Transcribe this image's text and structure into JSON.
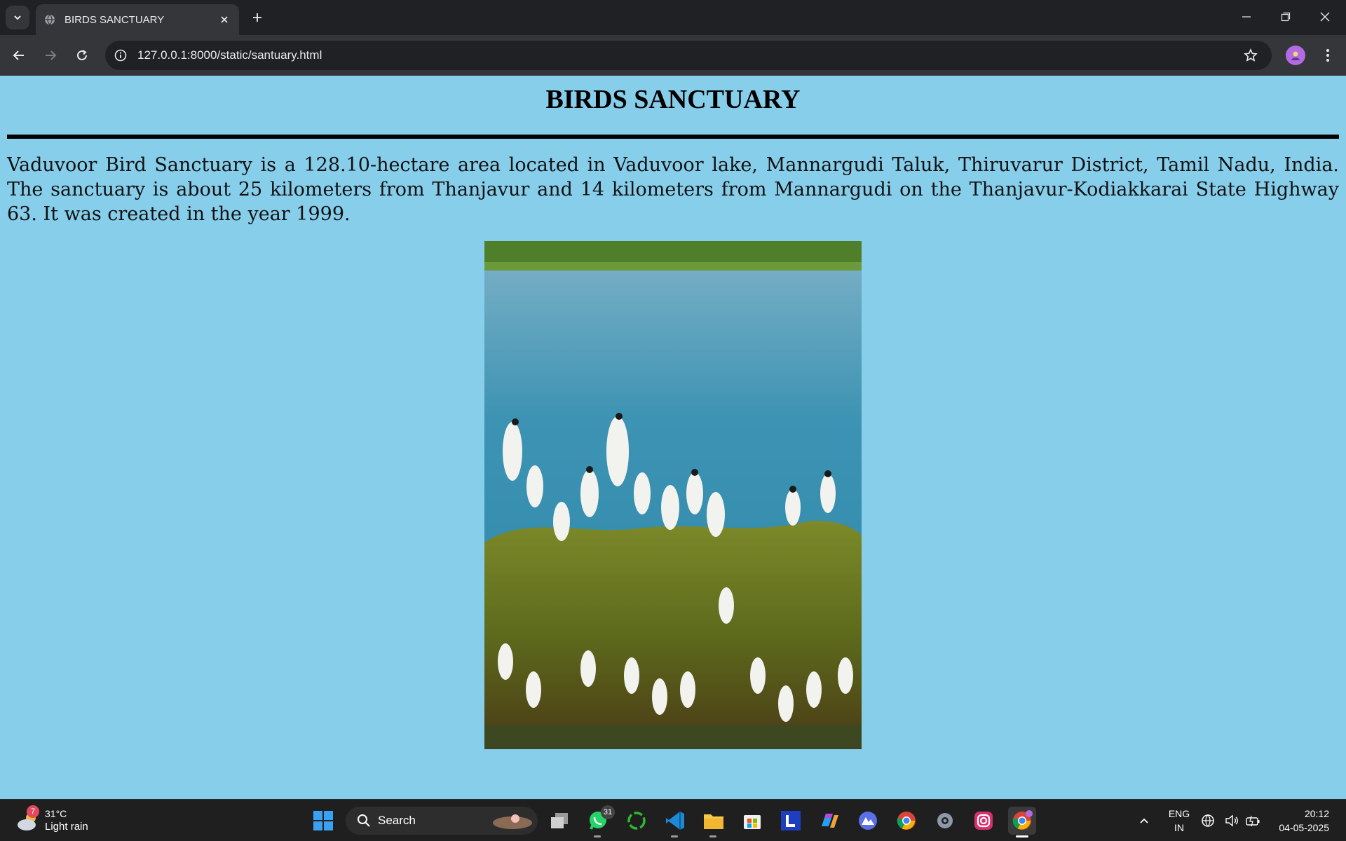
{
  "browser": {
    "tab_title": "BIRDS SANCTUARY",
    "url": "127.0.0.1:8000/static/santuary.html"
  },
  "page": {
    "heading": "BIRDS SANCTUARY",
    "paragraph": "Vaduvoor Bird Sanctuary is a 128.10-hectare area located in Vaduvoor lake, Mannargudi Taluk, Thiruvarur District, Tamil Nadu, India. The sanctuary is about 25 kilometers from Thanjavur and 14 kilometers from Mannargudi on the Thanjavur-Kodiakkarai State Highway 63. It was created in the year 1999.",
    "background_color": "#87CEEB"
  },
  "taskbar": {
    "weather": {
      "temp": "31°C",
      "desc": "Light rain",
      "badge": "7"
    },
    "search_label": "Search",
    "whatsapp_badge": "31",
    "lang_line1": "ENG",
    "lang_line2": "IN",
    "time": "20:12",
    "date": "04-05-2025"
  }
}
